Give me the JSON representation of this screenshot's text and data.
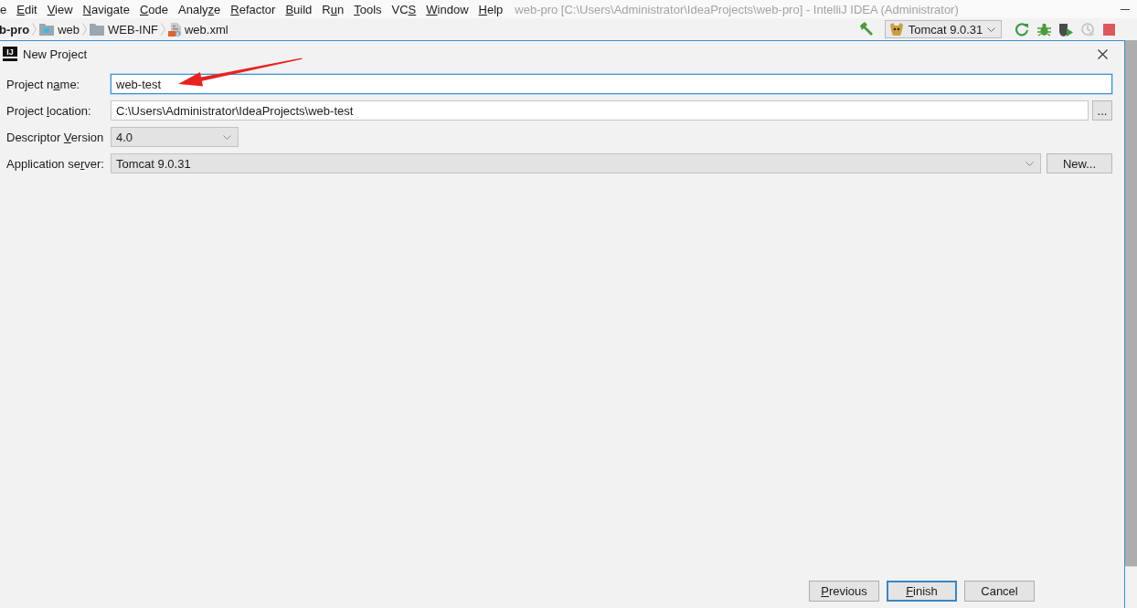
{
  "menu_bar": {
    "items": [
      {
        "pre": "e"
      },
      {
        "key": "E",
        "post": "dit"
      },
      {
        "key": "V",
        "post": "iew"
      },
      {
        "key": "N",
        "post": "avigate"
      },
      {
        "key": "C",
        "post": "ode"
      },
      {
        "pre": "Analy",
        "key": "z",
        "post": "e"
      },
      {
        "key": "R",
        "post": "efactor"
      },
      {
        "key": "B",
        "post": "uild"
      },
      {
        "pre": "R",
        "key": "u",
        "post": "n"
      },
      {
        "key": "T",
        "post": "ools"
      },
      {
        "pre": "VC",
        "key": "S"
      },
      {
        "key": "W",
        "post": "indow"
      },
      {
        "key": "H",
        "post": "elp"
      }
    ],
    "window_title": "web-pro [C:\\Users\\Administrator\\IdeaProjects\\web-pro] - IntelliJ IDEA (Administrator)"
  },
  "navigation_bar": {
    "breadcrumbs": [
      {
        "kind": "project",
        "label": "b-pro"
      },
      {
        "kind": "web-folder",
        "label": "web"
      },
      {
        "kind": "folder",
        "label": "WEB-INF"
      },
      {
        "kind": "xml-file",
        "label": "web.xml"
      }
    ],
    "run_configuration": "Tomcat 9.0.31"
  },
  "dialog": {
    "logo": "IJ",
    "title": "New Project",
    "fields": [
      {
        "kind": "text",
        "label": {
          "pre": "Project n",
          "key": "a",
          "post": "me:"
        },
        "value": "web-test",
        "focused": true
      },
      {
        "kind": "path",
        "label": {
          "pre": "Project ",
          "key": "l",
          "post": "ocation:"
        },
        "value": "C:\\Users\\Administrator\\IdeaProjects\\web-test",
        "focused": false,
        "browse": "..."
      },
      {
        "kind": "short-select",
        "label": {
          "pre": "Descriptor ",
          "key": "V",
          "post": "ersion"
        },
        "value": "4.0"
      },
      {
        "kind": "select",
        "label": {
          "pre": "Application se",
          "key": "r",
          "post": "ver:"
        },
        "value": "Tomcat 9.0.31",
        "button": "New..."
      }
    ],
    "buttons": [
      {
        "label": {
          "key": "P",
          "post": "revious"
        },
        "default": false
      },
      {
        "label": {
          "key": "F",
          "post": "inish"
        },
        "default": true
      },
      {
        "label": {
          "pre": "Cancel"
        },
        "default": false
      }
    ]
  }
}
